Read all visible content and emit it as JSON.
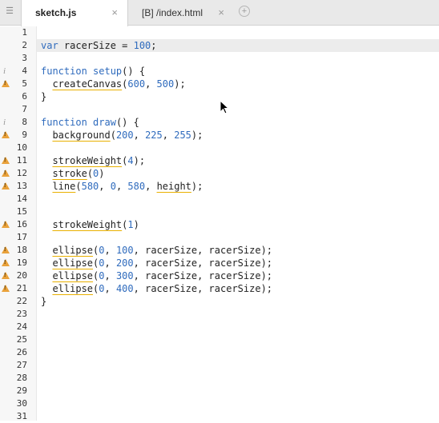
{
  "tabs": [
    {
      "label": "sketch.js",
      "close": "×",
      "active": true
    },
    {
      "label": "[B] /index.html",
      "close": "×",
      "active": false
    }
  ],
  "tab_menu_icon": "☰",
  "add_tab_icon": "+",
  "editor": {
    "line_numbers": [
      "1",
      "2",
      "3",
      "4",
      "5",
      "6",
      "7",
      "8",
      "9",
      "10",
      "11",
      "12",
      "13",
      "14",
      "15",
      "16",
      "17",
      "18",
      "19",
      "20",
      "21",
      "22",
      "23",
      "24",
      "25",
      "26",
      "27",
      "28",
      "29",
      "30",
      "31"
    ],
    "highlighted_line": 2,
    "markers": {
      "4": "info",
      "5": "warning",
      "8": "info",
      "9": "warning",
      "11": "warning",
      "12": "warning",
      "13": "warning",
      "16": "warning",
      "18": "warning",
      "19": "warning",
      "20": "warning",
      "21": "warning"
    },
    "lines": {
      "2": [
        [
          "kw",
          "var"
        ],
        [
          "t",
          " racerSize = "
        ],
        [
          "num",
          "100"
        ],
        [
          "t",
          ";"
        ]
      ],
      "4": [
        [
          "kw",
          "function"
        ],
        [
          "t",
          " "
        ],
        [
          "fn",
          "setup"
        ],
        [
          "t",
          "() {"
        ]
      ],
      "5": [
        [
          "t",
          "  "
        ],
        [
          "u",
          "createCanvas"
        ],
        [
          "t",
          "("
        ],
        [
          "num",
          "600"
        ],
        [
          "t",
          ", "
        ],
        [
          "num",
          "500"
        ],
        [
          "t",
          ");"
        ]
      ],
      "6": [
        [
          "t",
          "}"
        ]
      ],
      "8": [
        [
          "kw",
          "function"
        ],
        [
          "t",
          " "
        ],
        [
          "fn",
          "draw"
        ],
        [
          "t",
          "() {"
        ]
      ],
      "9": [
        [
          "t",
          "  "
        ],
        [
          "u",
          "background"
        ],
        [
          "t",
          "("
        ],
        [
          "num",
          "200"
        ],
        [
          "t",
          ", "
        ],
        [
          "num",
          "225"
        ],
        [
          "t",
          ", "
        ],
        [
          "num",
          "255"
        ],
        [
          "t",
          ");"
        ]
      ],
      "11": [
        [
          "t",
          "  "
        ],
        [
          "u",
          "strokeWeight"
        ],
        [
          "t",
          "("
        ],
        [
          "num",
          "4"
        ],
        [
          "t",
          ");"
        ]
      ],
      "12": [
        [
          "t",
          "  "
        ],
        [
          "u",
          "stroke"
        ],
        [
          "t",
          "("
        ],
        [
          "num",
          "0"
        ],
        [
          "t",
          ")"
        ]
      ],
      "13": [
        [
          "t",
          "  "
        ],
        [
          "u",
          "line"
        ],
        [
          "t",
          "("
        ],
        [
          "num",
          "580"
        ],
        [
          "t",
          ", "
        ],
        [
          "num",
          "0"
        ],
        [
          "t",
          ", "
        ],
        [
          "num",
          "580"
        ],
        [
          "t",
          ", "
        ],
        [
          "u",
          "height"
        ],
        [
          "t",
          ");"
        ]
      ],
      "16": [
        [
          "t",
          "  "
        ],
        [
          "u",
          "strokeWeight"
        ],
        [
          "t",
          "("
        ],
        [
          "num",
          "1"
        ],
        [
          "t",
          ")"
        ]
      ],
      "18": [
        [
          "t",
          "  "
        ],
        [
          "u",
          "ellipse"
        ],
        [
          "t",
          "("
        ],
        [
          "num",
          "0"
        ],
        [
          "t",
          ", "
        ],
        [
          "num",
          "100"
        ],
        [
          "t",
          ", racerSize, racerSize);"
        ]
      ],
      "19": [
        [
          "t",
          "  "
        ],
        [
          "u",
          "ellipse"
        ],
        [
          "t",
          "("
        ],
        [
          "num",
          "0"
        ],
        [
          "t",
          ", "
        ],
        [
          "num",
          "200"
        ],
        [
          "t",
          ", racerSize, racerSize);"
        ]
      ],
      "20": [
        [
          "t",
          "  "
        ],
        [
          "u",
          "ellipse"
        ],
        [
          "t",
          "("
        ],
        [
          "num",
          "0"
        ],
        [
          "t",
          ", "
        ],
        [
          "num",
          "300"
        ],
        [
          "t",
          ", racerSize, racerSize);"
        ]
      ],
      "21": [
        [
          "t",
          "  "
        ],
        [
          "u",
          "ellipse"
        ],
        [
          "t",
          "("
        ],
        [
          "num",
          "0"
        ],
        [
          "t",
          ", "
        ],
        [
          "num",
          "400"
        ],
        [
          "t",
          ", racerSize, racerSize);"
        ]
      ],
      "22": [
        [
          "t",
          "}"
        ]
      ]
    }
  },
  "colors": {
    "keyword": "#2f6bbd",
    "warning": "#e9a13a",
    "underline": "#e9b000",
    "active_line": "#ececec"
  }
}
